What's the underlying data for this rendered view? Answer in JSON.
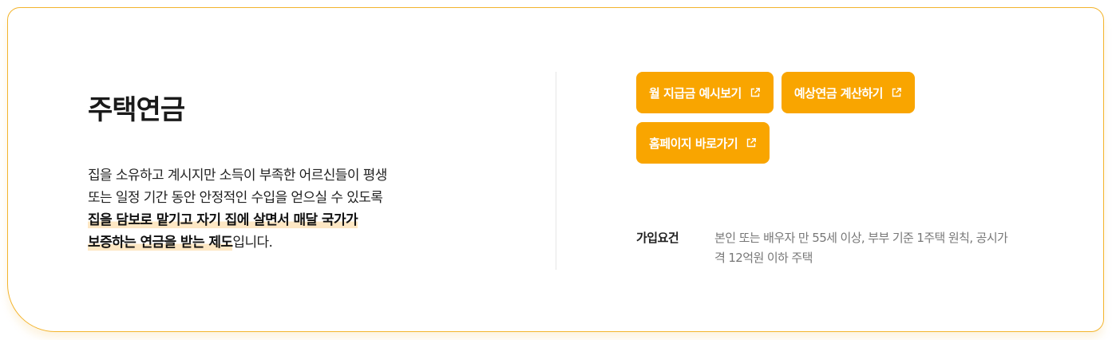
{
  "section": {
    "title": "주택연금",
    "description": {
      "line1": "집을 소유하고 계시지만 소득이 부족한 어르신들이 평생",
      "line2": "또는 일정 기간 동안 안정적인 수입을 얻으실 수 있도록",
      "highlight_line1": "집을 담보로 맡기고 자기 집에 살면서 매달 국가가",
      "highlight_line2": "보증하는 연금을 받는 제도",
      "suffix": "입니다."
    }
  },
  "buttons": {
    "monthly_preview": "월 지급금 예시보기",
    "expected_pension": "예상연금 계산하기",
    "homepage": "홈페이지 바로가기"
  },
  "icons": {
    "external_link": "external-link-icon"
  },
  "eligibility": {
    "label": "가입요건",
    "text": "본인 또는 배우자 만 55세 이상, 부부 기준 1주택 원칙, 공시가격 12억원 이하 주택"
  },
  "colors": {
    "accent": "#f9a500",
    "border": "#f3b42d",
    "highlight": "#fde7c4"
  }
}
